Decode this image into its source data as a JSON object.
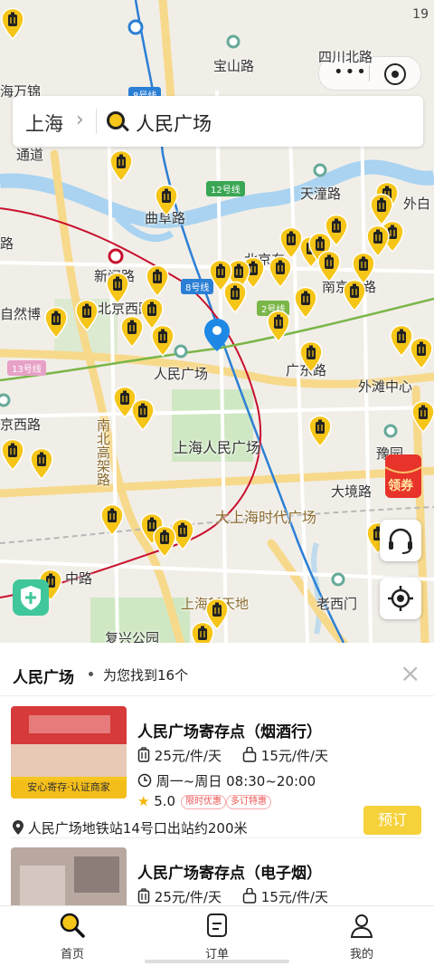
{
  "status_bar": {
    "time": "19"
  },
  "capsule": {
    "dots": "•••"
  },
  "search": {
    "city": "上海",
    "chevron": "›",
    "query": "人民广场"
  },
  "map": {
    "labels": {
      "baoshan_rd": "宝山路",
      "sichuan_n_rd": "四川北路",
      "haining_rd": "海万锦",
      "qufu_rd": "曲阜路",
      "tiantong_rd": "天潼路",
      "waibaidu": "外白",
      "xinzha_rd": "新闸路",
      "beijing_w_rd": "北京西路",
      "natural_museum": "自然博",
      "beijing_e_rd": "北京东",
      "nanjing_rd": "南京东路",
      "peoples_square": "人民广场",
      "bund_center": "外滩中心",
      "nanbei_elevated": "南北高架路",
      "shanghai_peoples_square": "上海人民广场",
      "yu_garden": "豫园",
      "dajing_rd": "大境路",
      "shanghai_times_square": "大上海时代广场",
      "weihai_rd": "京西路",
      "xintiandi": "上海新天地",
      "laoximen": "老西门",
      "fuxing_park": "复兴公园",
      "zhong_rd": "中路",
      "guangdong_rd": "广东路",
      "lu": "路",
      "tong_dao": "通道"
    },
    "line_badges": {
      "l8a": "8号线",
      "l12": "12号线",
      "l8b": "8号线",
      "l2": "2号线",
      "l13": "13号线"
    },
    "colors": {
      "water": "#a9d3f0",
      "road": "#f7d98b",
      "park": "#cfe8c3",
      "pin": "#f5c518",
      "line_blue": "#2b7fd4",
      "line_red": "#c8102e",
      "line_green": "#7ab648"
    }
  },
  "red_packet": {
    "label": "领券"
  },
  "panel": {
    "title": "人民广场",
    "count_text": "为您找到16个",
    "close": "×"
  },
  "stores": [
    {
      "name": "人民广场寄存点（烟酒行）",
      "big_price": "25元/件/天",
      "small_price": "15元/件/天",
      "hours": "周一~周日 08:30~20:00",
      "rating": "5.0",
      "tags": [
        "限时优惠",
        "多订特惠"
      ],
      "badge": "安心寄存·认证商家",
      "address": "人民广场地铁站14号口出站约200米",
      "book": "预订"
    },
    {
      "name": "人民广场寄存点（电子烟）",
      "big_price": "25元/件/天",
      "small_price": "15元/件/天"
    }
  ],
  "tabbar": {
    "home": "首页",
    "orders": "订单",
    "mine": "我的"
  }
}
